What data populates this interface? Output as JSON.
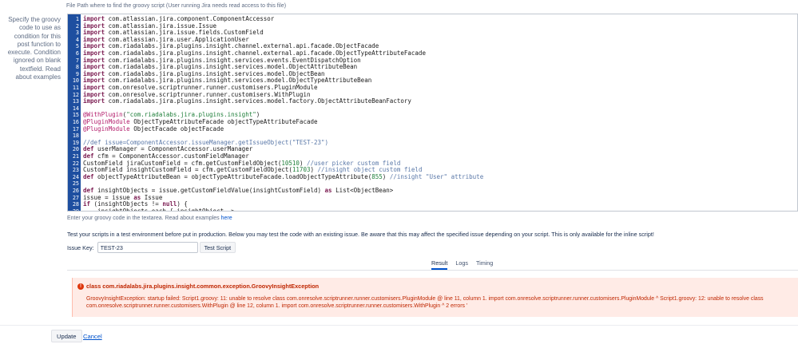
{
  "file_path_hint": "File Path where to find the groovy script (User running Jira needs read access to this file)",
  "left_help": {
    "text": "Specify the groovy code to use as condition for this post function to execute. Condition ignored on blank textfield. Read about examples"
  },
  "editor": {
    "lines": [
      {
        "n": "1",
        "parts": [
          [
            "kw",
            "import"
          ],
          [
            "t",
            " com.atlassian.jira.component.ComponentAccessor"
          ]
        ]
      },
      {
        "n": "2",
        "parts": [
          [
            "kw",
            "import"
          ],
          [
            "t",
            " com.atlassian.jira.issue.Issue"
          ]
        ]
      },
      {
        "n": "3",
        "parts": [
          [
            "kw",
            "import"
          ],
          [
            "t",
            " com.atlassian.jira.issue.fields.CustomField"
          ]
        ]
      },
      {
        "n": "4",
        "parts": [
          [
            "kw",
            "import"
          ],
          [
            "t",
            " com.atlassian.jira.user.ApplicationUser"
          ]
        ]
      },
      {
        "n": "5",
        "parts": [
          [
            "kw",
            "import"
          ],
          [
            "t",
            " com.riadalabs.jira.plugins.insight.channel.external.api.facade.ObjectFacade"
          ]
        ]
      },
      {
        "n": "6",
        "parts": [
          [
            "kw",
            "import"
          ],
          [
            "t",
            " com.riadalabs.jira.plugins.insight.channel.external.api.facade.ObjectTypeAttributeFacade"
          ]
        ]
      },
      {
        "n": "7",
        "parts": [
          [
            "kw",
            "import"
          ],
          [
            "t",
            " com.riadalabs.jira.plugins.insight.services.events.EventDispatchOption"
          ]
        ]
      },
      {
        "n": "8",
        "parts": [
          [
            "kw",
            "import"
          ],
          [
            "t",
            " com.riadalabs.jira.plugins.insight.services.model.ObjectAttributeBean"
          ]
        ]
      },
      {
        "n": "9",
        "parts": [
          [
            "kw",
            "import"
          ],
          [
            "t",
            " com.riadalabs.jira.plugins.insight.services.model.ObjectBean"
          ]
        ]
      },
      {
        "n": "10",
        "parts": [
          [
            "kw",
            "import"
          ],
          [
            "t",
            " com.riadalabs.jira.plugins.insight.services.model.ObjectTypeAttributeBean"
          ]
        ]
      },
      {
        "n": "11",
        "parts": [
          [
            "kw",
            "import"
          ],
          [
            "t",
            " com.onresolve.scriptrunner.runner.customisers.PluginModule"
          ]
        ]
      },
      {
        "n": "12",
        "parts": [
          [
            "kw",
            "import"
          ],
          [
            "t",
            " com.onresolve.scriptrunner.runner.customisers.WithPlugin"
          ]
        ]
      },
      {
        "n": "13",
        "parts": [
          [
            "kw",
            "import"
          ],
          [
            "t",
            " com.riadalabs.jira.plugins.insight.services.model.factory.ObjectAttributeBeanFactory"
          ]
        ]
      },
      {
        "n": "14",
        "parts": []
      },
      {
        "n": "15",
        "parts": [
          [
            "ann",
            "@WithPlugin"
          ],
          [
            "t",
            "("
          ],
          [
            "str",
            "\"com.riadalabs.jira.plugins.insight\""
          ],
          [
            "t",
            ")"
          ]
        ]
      },
      {
        "n": "16",
        "parts": [
          [
            "ann",
            "@PluginModule"
          ],
          [
            "t",
            " ObjectTypeAttributeFacade objectTypeAttributeFacade"
          ]
        ]
      },
      {
        "n": "17",
        "parts": [
          [
            "ann",
            "@PluginModule"
          ],
          [
            "t",
            " ObjectFacade objectFacade"
          ]
        ]
      },
      {
        "n": "18",
        "parts": []
      },
      {
        "n": "19",
        "parts": [
          [
            "cmt",
            "//def issue=ComponentAccessor.issueManager.getIssueObject(\"TEST-23\")"
          ]
        ]
      },
      {
        "n": "20",
        "parts": [
          [
            "kw",
            "def"
          ],
          [
            "t",
            " userManager = ComponentAccessor.userManager"
          ]
        ]
      },
      {
        "n": "21",
        "parts": [
          [
            "kw",
            "def"
          ],
          [
            "t",
            " cfm = ComponentAccessor.customFieldManager"
          ]
        ]
      },
      {
        "n": "22",
        "parts": [
          [
            "t",
            "CustomField jiraCustomField = cfm.getCustomFieldObject("
          ],
          [
            "num",
            "10510"
          ],
          [
            "t",
            ") "
          ],
          [
            "cmt",
            "//user picker custom field"
          ]
        ]
      },
      {
        "n": "23",
        "parts": [
          [
            "t",
            "CustomField insightCustomField = cfm.getCustomFieldObject("
          ],
          [
            "num",
            "11703"
          ],
          [
            "t",
            ") "
          ],
          [
            "cmt",
            "//insight object custom field"
          ]
        ]
      },
      {
        "n": "24",
        "parts": [
          [
            "kw",
            "def"
          ],
          [
            "t",
            " objectTypeAttributeBean = objectTypeAttributeFacade.loadObjectTypeAttribute("
          ],
          [
            "num",
            "855"
          ],
          [
            "t",
            ") "
          ],
          [
            "cmt",
            "//insight \"User\" attribute"
          ]
        ]
      },
      {
        "n": "25",
        "parts": []
      },
      {
        "n": "26",
        "parts": [
          [
            "kw",
            "def"
          ],
          [
            "t",
            " insightObjects = issue.getCustomFieldValue(insightCustomField) "
          ],
          [
            "kw",
            "as"
          ],
          [
            "t",
            " List<ObjectBean>"
          ]
        ]
      },
      {
        "n": "27",
        "parts": [
          [
            "t",
            "issue = issue "
          ],
          [
            "kw",
            "as"
          ],
          [
            "t",
            " Issue"
          ]
        ]
      },
      {
        "n": "28",
        "parts": [
          [
            "kw",
            "if"
          ],
          [
            "t",
            " (insightObjects != "
          ],
          [
            "kw",
            "null"
          ],
          [
            "t",
            ") {"
          ]
        ]
      },
      {
        "n": "29",
        "parts": [
          [
            "t",
            "    insightObjects.each { insightObject ->"
          ]
        ]
      }
    ]
  },
  "code_hint": {
    "text": "Enter your groovy code in the textarea. Read about examples ",
    "link": "here"
  },
  "test_description": "Test your scripts in a test environment before put in production. Below you may test the code with an existing issue. Be aware that this may affect the specified issue depending on your script. This is only available for the inline script!",
  "issue_key": {
    "label": "Issue Key:",
    "value": "TEST-23"
  },
  "test_button_label": "Test Script",
  "tabs": [
    {
      "label": "Result",
      "active": true
    },
    {
      "label": "Logs",
      "active": false
    },
    {
      "label": "Timing",
      "active": false
    }
  ],
  "error": {
    "icon": "error-icon",
    "title": "class com.riadalabs.jira.plugins.insight.common.exception.GroovyInsightException",
    "message": "GroovyInsightException: startup failed: Script1.groovy: 11: unable to resolve class com.onresolve.scriptrunner.runner.customisers.PluginModule @ line 11, column 1. import com.onresolve.scriptrunner.runner.customisers.PluginModule ^ Script1.groovy: 12: unable to resolve class com.onresolve.scriptrunner.runner.customisers.WithPlugin @ line 12, column 1. import com.onresolve.scriptrunner.runner.customisers.WithPlugin ^ 2 errors '"
  },
  "footer": {
    "update_label": "Update",
    "cancel_label": "Cancel"
  },
  "colors": {
    "gutter": "#1e4fa0",
    "link": "#0052cc",
    "error_bg": "#ffebe6",
    "error_text": "#bf2600"
  }
}
